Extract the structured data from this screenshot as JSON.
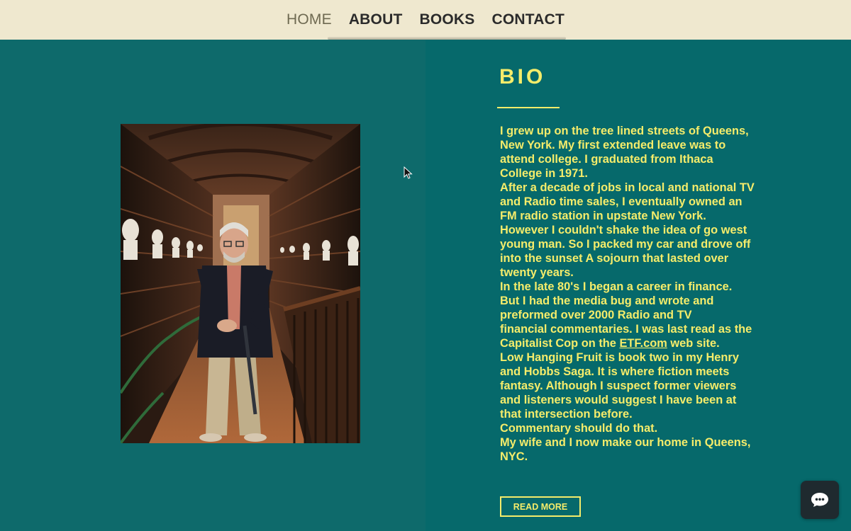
{
  "nav": {
    "items": [
      {
        "label": "HOME",
        "active": true
      },
      {
        "label": "ABOUT",
        "active": false
      },
      {
        "label": "BOOKS",
        "active": false
      },
      {
        "label": "CONTACT",
        "active": false
      }
    ]
  },
  "bio": {
    "title": "BIO",
    "paragraph_before_link": "I grew up on the tree lined streets of Queens, New York. My first extended  leave was to attend college.  I graduated from Ithaca College in 1971.\nAfter a decade of jobs in local and national TV and Radio time sales, I eventually owned an FM radio station in upstate New York.\n However I couldn't shake the idea of go west young man. So I packed my car and drove off into the sunset A sojourn that lasted over twenty years.\nIn the late 80's I began a career in finance.\n But I had the media bug and wrote and preformed over 2000 Radio and TV\n financial commentaries.  I was last read as the Capitalist  Cop on the ",
    "link_text": "ETF.com",
    "paragraph_after_link": " web site.\nLow Hanging Fruit is book two in my Henry and Hobbs Saga. It is where fiction meets fantasy.  Although I suspect former viewers and listeners would suggest I have been at that intersection before.\nCommentary should do that.\nMy wife and I now make our home in Queens, NYC.",
    "read_more_label": "READ MORE"
  },
  "photo": {
    "description_icon": "portrait-photo"
  },
  "chat": {
    "icon": "chat-bubble-icon"
  },
  "colors": {
    "background": "#0b6b6c",
    "nav_background": "#efe8cf",
    "accent_yellow": "#f5ec6a",
    "chat_button": "#1f2a2f"
  }
}
